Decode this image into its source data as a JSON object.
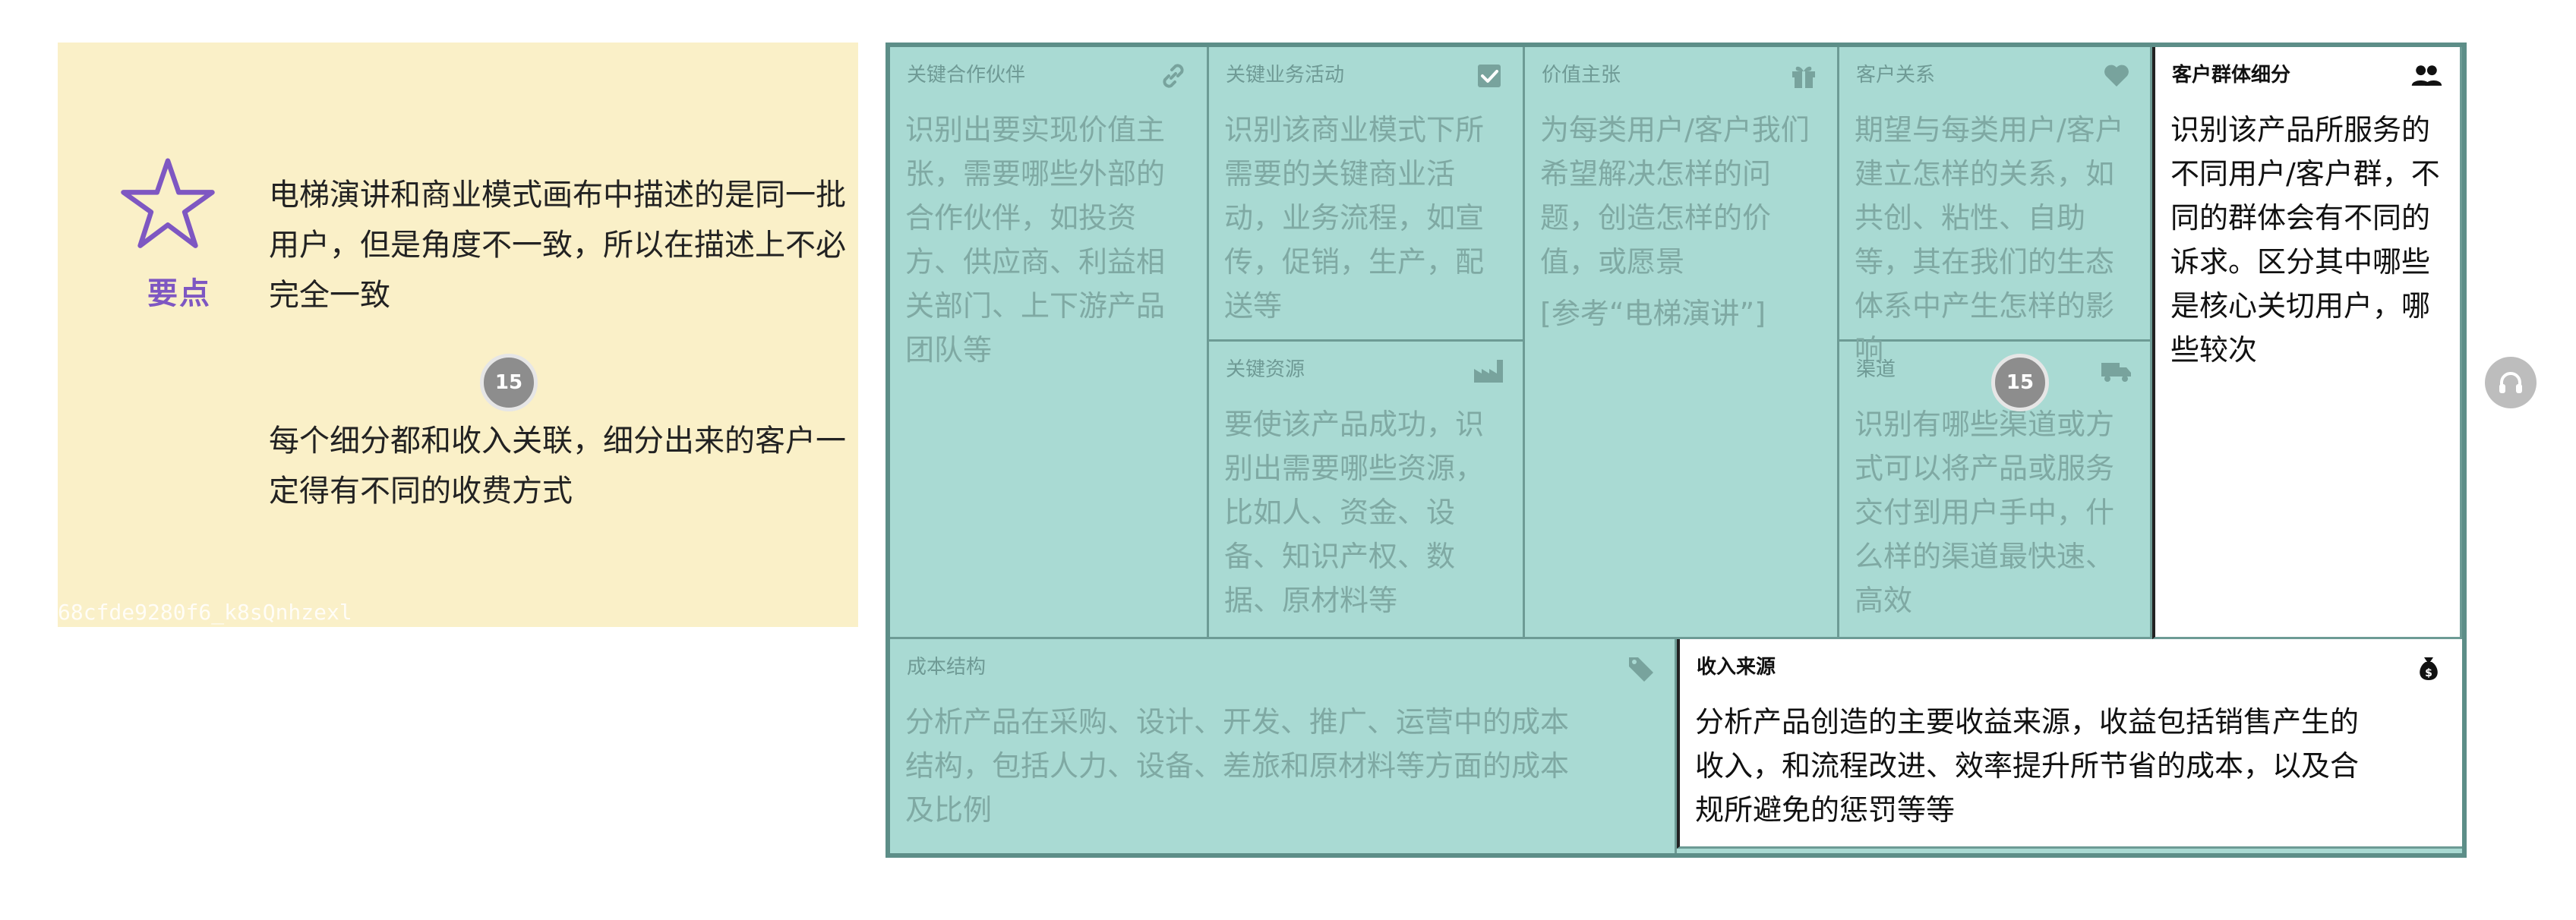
{
  "note": {
    "label": "要点",
    "para1": "电梯演讲和商业模式画布中描述的是同一批用户，但是角度不一致，所以在描述上不必完全一致",
    "para2": "每个细分都和收入关联，细分出来的客户一定得有不同的收费方式",
    "id_strip": "68cfde9280f6_k8sQnhzexl"
  },
  "replay": {
    "seconds": "15"
  },
  "canvas": {
    "key_partners": {
      "title": "关键合作伙伴",
      "body": "识别出要实现价值主张，需要哪些外部的合作伙伴，如投资方、供应商、利益相关部门、上下游产品团队等",
      "icon": "link-icon"
    },
    "key_activities": {
      "title": "关键业务活动",
      "body": "识别该商业模式下所需要的关键商业活动，业务流程，如宣传，促销，生产，配送等",
      "icon": "checkbox-icon"
    },
    "key_resources": {
      "title": "关键资源",
      "body": "要使该产品成功，识别出需要哪些资源，比如人、资金、设备、知识产权、数据、原材料等",
      "icon": "factory-icon"
    },
    "value_propositions": {
      "title": "价值主张",
      "body": "为每类用户/客户我们希望解决怎样的问题，创造怎样的价值，或愿景",
      "extra": "[参考“电梯演讲”]",
      "icon": "gift-icon"
    },
    "customer_relationships": {
      "title": "客户关系",
      "body": "期望与每类用户/客户建立怎样的关系，如共创、粘性、自助等，其在我们的生态体系中产生怎样的影响",
      "icon": "heart-icon"
    },
    "channels": {
      "title": "渠道",
      "body": "识别有哪些渠道或方式可以将产品或服务交付到用户手中，什么样的渠道最快速、高效",
      "icon": "delivery-truck-icon"
    },
    "customer_segments": {
      "title": "客户群体细分",
      "body": "识别该产品所服务的不同用户/客户群，不同的群体会有不同的诉求。区分其中哪些是核心关切用户，哪些较次",
      "icon": "users-icon"
    },
    "cost_structure": {
      "title": "成本结构",
      "body": "分析产品在采购、设计、开发、推广、运营中的成本结构，包括人力、设备、差旅和原材料等方面的成本及比例",
      "icon": "tag-icon"
    },
    "revenue_streams": {
      "title": "收入来源",
      "body": "分析产品创造的主要收益来源，收益包括销售产生的收入，和流程改进、效率提升所节省的成本，以及合规所避免的惩罚等等",
      "icon": "money-bag-icon"
    }
  },
  "colors": {
    "note_bg": "#faf0c8",
    "canvas_bg": "#a9dad3",
    "accent_purple": "#7e57c2"
  }
}
